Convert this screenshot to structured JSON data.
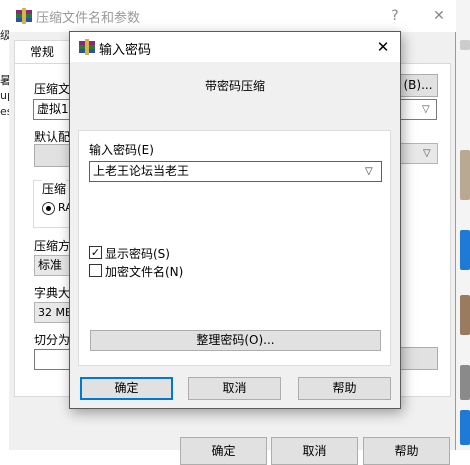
{
  "background": {
    "left_sliver_glyphs": [
      "级",
      "暑",
      "up",
      "es"
    ]
  },
  "main_window": {
    "title": "压缩文件名和参数",
    "help_button": "?",
    "close_button": "✕",
    "tab_general": "常规",
    "archive_name_label": "压缩文",
    "archive_name_value": "虚拟1",
    "browse_button": "(B)...",
    "default_profile_label": "默认配",
    "format_group_label": "压缩",
    "format_radio_label": "RA",
    "method_label": "压缩方",
    "method_value": "标准",
    "dictionary_label": "字典大",
    "dictionary_value": "32 MB",
    "split_label": "切分为",
    "ok_button": "确定",
    "cancel_button": "取消",
    "help_bottom_button": "帮助"
  },
  "password_dialog": {
    "title": "输入密码",
    "close_button": "✕",
    "heading": "带密码压缩",
    "password_label": "输入密码(E)",
    "password_value": "上老王论坛当老王",
    "show_password_label": "显示密码(S)",
    "show_password_checked": true,
    "encrypt_names_label": "加密文件名(N)",
    "encrypt_names_checked": false,
    "manage_button": "整理密码(O)...",
    "ok_button": "确定",
    "cancel_button": "取消",
    "help_button": "帮助",
    "accent_color": "#0078d7"
  }
}
